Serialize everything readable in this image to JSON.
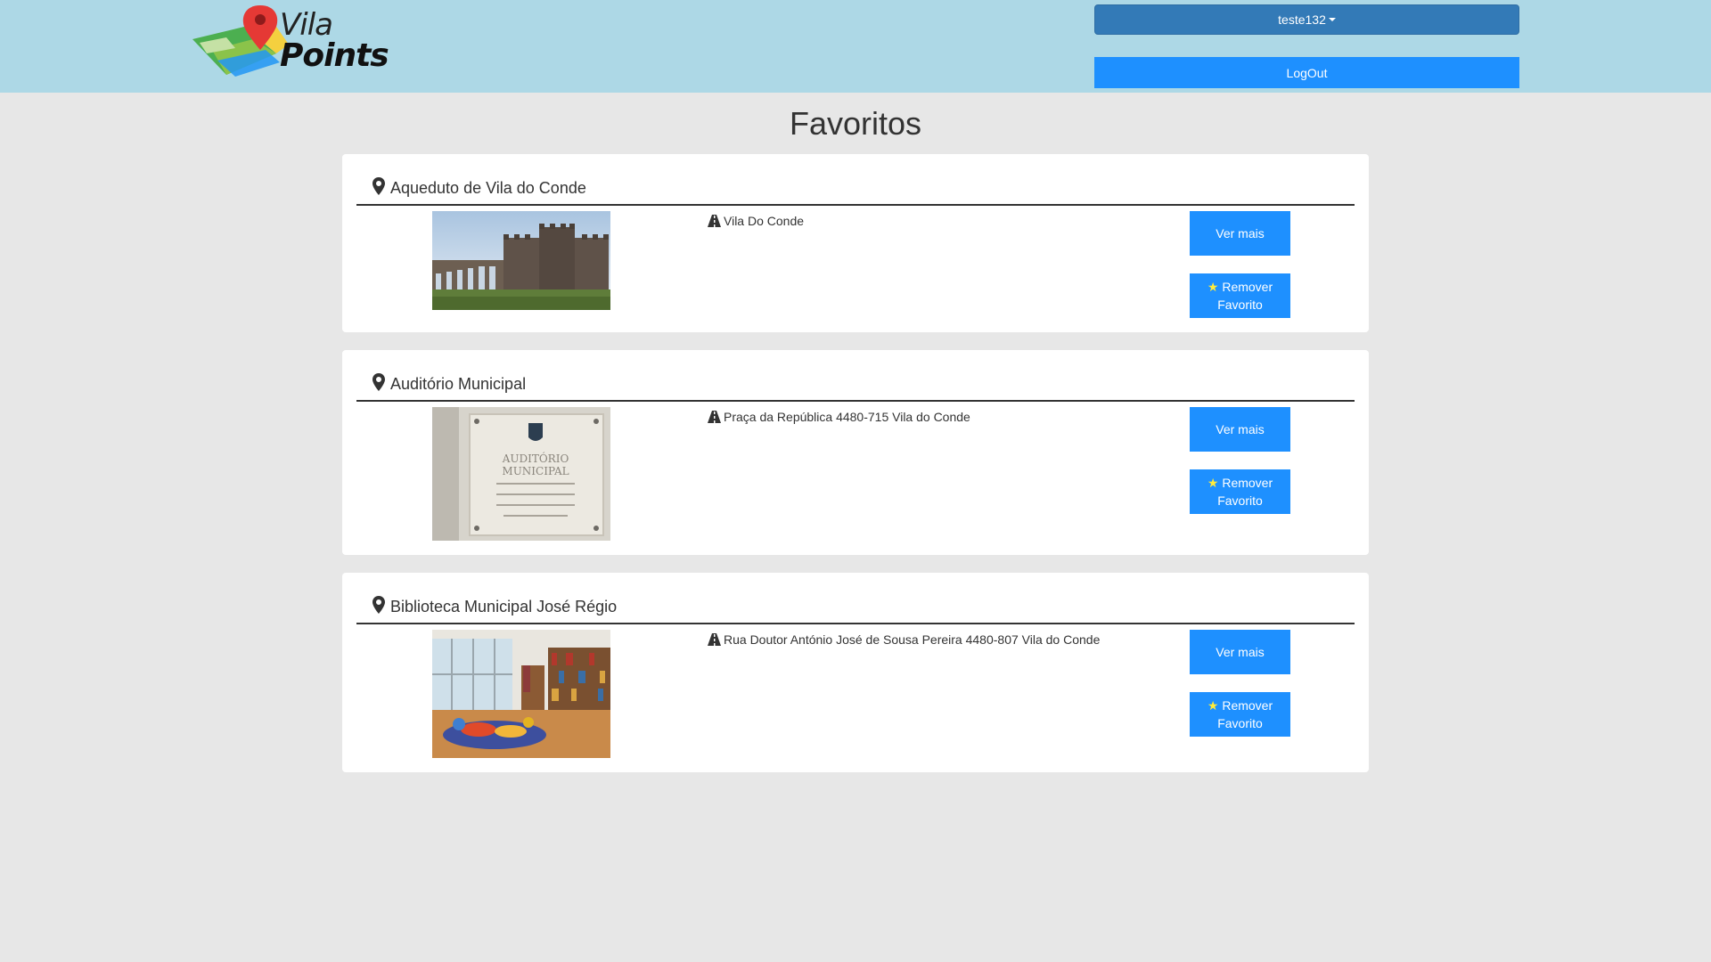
{
  "header": {
    "logo_line1": "Vila",
    "logo_line2": "Points",
    "user_label": "teste132",
    "logout_label": "LogOut"
  },
  "page": {
    "title": "Favoritos"
  },
  "favorites": [
    {
      "name": "Aqueduto de Vila do Conde",
      "address": "Vila Do Conde",
      "more_label": "Ver mais",
      "remove_label_1": "Remover",
      "remove_label_2": "Favorito"
    },
    {
      "name": "Auditório Municipal",
      "address": "Praça da República 4480-715 Vila do Conde",
      "more_label": "Ver mais",
      "remove_label_1": "Remover",
      "remove_label_2": "Favorito",
      "plaque_line1": "AUDITÓRIO",
      "plaque_line2": "MUNICIPAL"
    },
    {
      "name": "Biblioteca Municipal José Régio",
      "address": "Rua Doutor António José de Sousa Pereira 4480-807 Vila do Conde",
      "more_label": "Ver mais",
      "remove_label_1": "Remover",
      "remove_label_2": "Favorito"
    }
  ],
  "icons": {
    "pin": "map-marker-icon",
    "road": "road-icon",
    "star": "star-icon"
  },
  "colors": {
    "header_bg": "#add8e6",
    "primary_button": "#1e90ff",
    "user_button": "#337ab7",
    "page_bg": "#e7e7e7",
    "star": "#ffeb3b"
  }
}
